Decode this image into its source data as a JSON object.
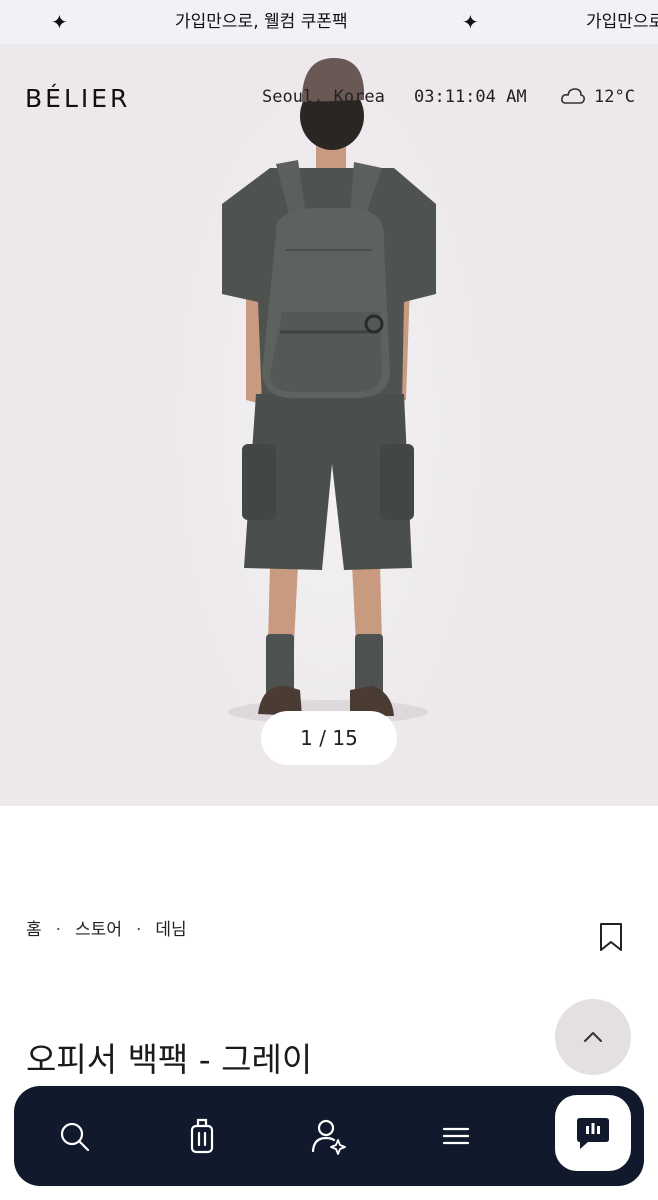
{
  "banner": {
    "items": [
      {
        "icon": "sparkle-icon",
        "star": "✦",
        "text": "가입만으로, 웰컴 쿠폰팩"
      },
      {
        "icon": "sparkle-icon",
        "star": "✦",
        "text": "가입만으로,"
      }
    ]
  },
  "header": {
    "logo": "BÉLIER",
    "location": "Seoul, Korea",
    "time": "03:11:04 AM",
    "weather_icon": "cloud-icon",
    "temperature": "12°C"
  },
  "gallery": {
    "counter": "1 / 15",
    "current": 1,
    "total": 15,
    "image_alt": "gray backpack worn by model, rear view"
  },
  "breadcrumb": {
    "items": [
      "홈",
      "스토어",
      "데님"
    ],
    "separator": "·"
  },
  "product": {
    "title": "오피서 백팩 - 그레이",
    "bookmark_icon": "bookmark-icon"
  },
  "scroll_top": {
    "icon": "chevron-up-icon"
  },
  "bottom_nav": {
    "items": [
      {
        "icon": "search-icon"
      },
      {
        "icon": "luggage-icon"
      },
      {
        "icon": "user-sparkle-icon"
      },
      {
        "icon": "menu-icon"
      }
    ],
    "chat_icon": "chat-icon"
  },
  "colors": {
    "nav_bg": "#101a2c",
    "hero_bg": "#ece8ec",
    "banner_bg": "#f2f2f6"
  }
}
